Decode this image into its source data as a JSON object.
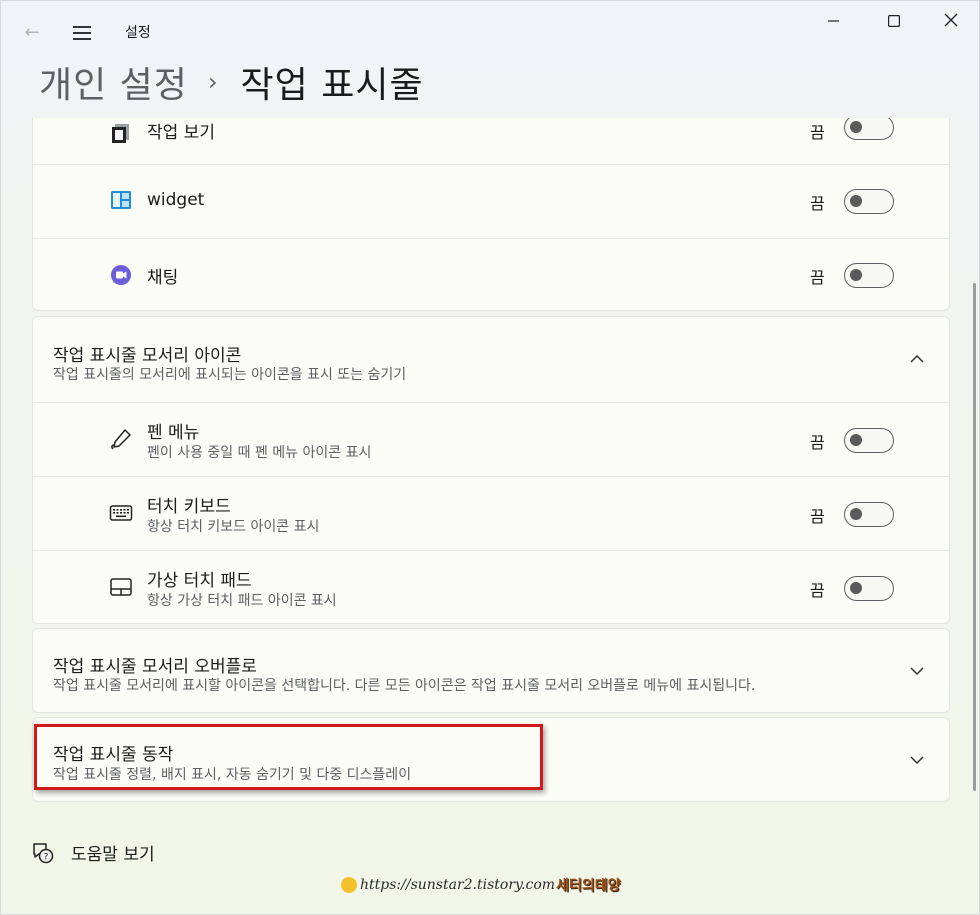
{
  "app": {
    "title": "설정"
  },
  "header": {
    "parent": "개인 설정",
    "separator": "›",
    "current": "작업 표시줄"
  },
  "top_items": [
    {
      "label": "작업 보기",
      "state": "끔",
      "icon": "task-view-icon"
    },
    {
      "label": "widget",
      "state": "끔",
      "icon": "widgets-icon"
    },
    {
      "label": "채팅",
      "state": "끔",
      "icon": "chat-icon"
    }
  ],
  "corner_icons": {
    "title": "작업 표시줄 모서리 아이콘",
    "subtitle": "작업 표시줄의 모서리에 표시되는 아이콘을 표시 또는 숨기기",
    "expanded": true,
    "items": [
      {
        "label": "펜 메뉴",
        "sub": "펜이 사용 중일 때 펜 메뉴 아이콘 표시",
        "state": "끔",
        "icon": "pen-icon"
      },
      {
        "label": "터치 키보드",
        "sub": "항상 터치 키보드 아이콘 표시",
        "state": "끔",
        "icon": "keyboard-icon"
      },
      {
        "label": "가상 터치 패드",
        "sub": "항상 가상 터치 패드 아이콘 표시",
        "state": "끔",
        "icon": "touchpad-icon"
      }
    ]
  },
  "overflow": {
    "title": "작업 표시줄 모서리 오버플로",
    "subtitle": "작업 표시줄 모서리에 표시할 아이콘을 선택합니다. 다른 모든 아이콘은 작업 표시줄 모서리 오버플로 메뉴에 표시됩니다."
  },
  "behaviors": {
    "title": "작업 표시줄 동작",
    "subtitle": "작업 표시줄 정렬, 배지 표시, 자동 숨기기 및 다중 디스플레이"
  },
  "help": {
    "label": "도움말 보기"
  },
  "watermark": {
    "url": "https://sunstar2.tistory.com",
    "name": "세터의태양"
  },
  "colors": {
    "highlight": "#d01919",
    "background": "#f2f4f0"
  }
}
